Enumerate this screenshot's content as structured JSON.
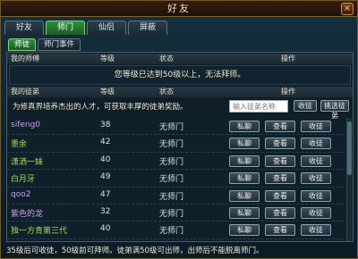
{
  "window": {
    "title": "好友",
    "close_label": "×"
  },
  "tabs": [
    {
      "label": "好友",
      "active": false
    },
    {
      "label": "师门",
      "active": true
    },
    {
      "label": "仙侣",
      "active": false
    },
    {
      "label": "屏蔽",
      "active": false
    }
  ],
  "subtabs": [
    {
      "label": "师徒",
      "active": true
    },
    {
      "label": "师门事件",
      "active": false
    }
  ],
  "master_header": {
    "col_name": "我的师傅",
    "col_level": "等级",
    "col_status": "状态",
    "col_action": "操作"
  },
  "master_message": "您等级已达到50级以上，无法拜师。",
  "disciple_header": {
    "col_name": "我的徒弟",
    "col_level": "等级",
    "col_status": "状态",
    "col_action": "操作"
  },
  "recruit": {
    "text": "为修真界培养杰出的人才，可获取丰厚的徒弟奖励。",
    "input_placeholder": "输入徒弟名称",
    "recruit_button": "收徒",
    "pick_button": "挑选徒弟"
  },
  "disciples": [
    {
      "name": "sifeng0",
      "level": "38",
      "status": "无师门",
      "name_color": "#c8a0e8"
    },
    {
      "name": "墨余",
      "level": "42",
      "status": "无师门",
      "name_color": "#9fdc5a"
    },
    {
      "name": "潇洒一妹",
      "level": "40",
      "status": "无师门",
      "name_color": "#9fdc5a"
    },
    {
      "name": "白月牙",
      "level": "49",
      "status": "无师门",
      "name_color": "#9fdc5a"
    },
    {
      "name": "qoo2",
      "level": "47",
      "status": "无师门",
      "name_color": "#c8a0e8"
    },
    {
      "name": "紫色的龙",
      "level": "32",
      "status": "无师门",
      "name_color": "#c8a0e8"
    },
    {
      "name": "独一方青第三代",
      "level": "40",
      "status": "无师门",
      "name_color": "#9fdc5a"
    }
  ],
  "row_buttons": {
    "whisper": "私聊",
    "view": "查看",
    "recruit": "收徒"
  },
  "footer": "35级后可收徒，50级前可拜师。徒弟满50级可出师，出师后不能脱离师门。"
}
